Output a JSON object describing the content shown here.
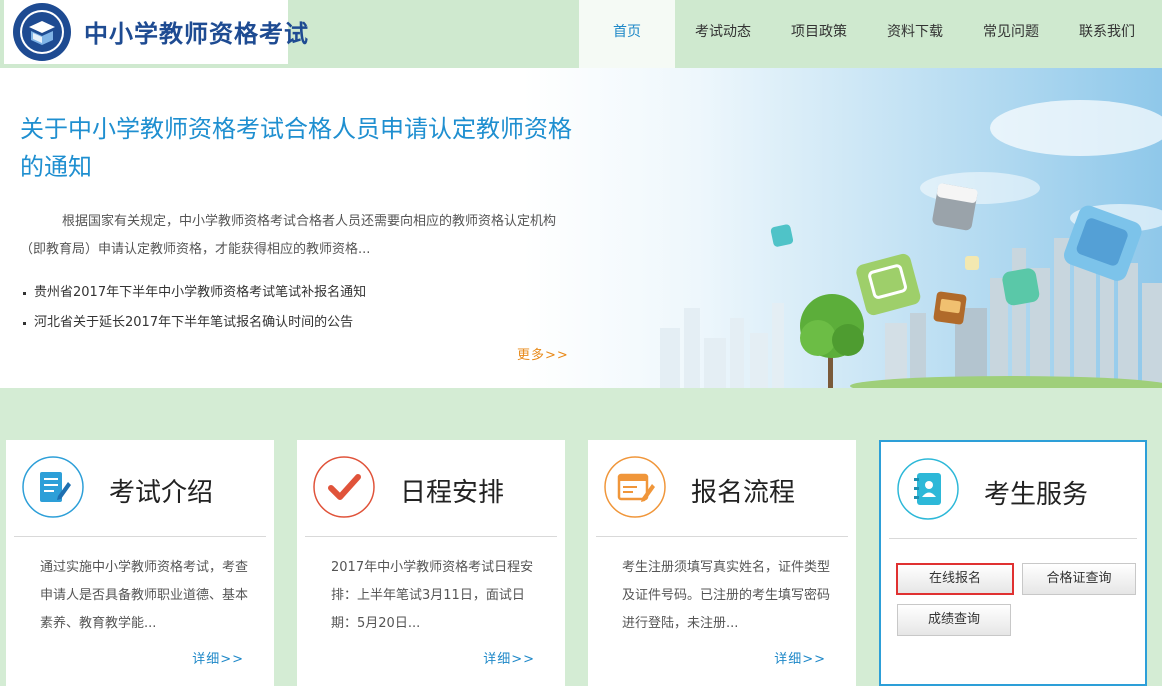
{
  "header": {
    "site_title": "中小学教师资格考试",
    "nav": [
      {
        "label": "首页",
        "active": true
      },
      {
        "label": "考试动态"
      },
      {
        "label": "项目政策"
      },
      {
        "label": "资料下载"
      },
      {
        "label": "常见问题"
      },
      {
        "label": "联系我们"
      }
    ]
  },
  "banner": {
    "title": "关于中小学教师资格考试合格人员申请认定教师资格的通知",
    "description": "根据国家有关规定，中小学教师资格考试合格者人员还需要向相应的教师资格认定机构（即教育局）申请认定教师资格，才能获得相应的教师资格...",
    "news": [
      "贵州省2017年下半年中小学教师资格考试笔试补报名通知",
      "河北省关于延长2017年下半年笔试报名确认时间的公告"
    ],
    "more_label": "更多>>"
  },
  "cards": [
    {
      "title": "考试介绍",
      "icon": "document-edit-icon",
      "text": "通过实施中小学教师资格考试，考查申请人是否具备教师职业道德、基本素养、教育教学能...",
      "more_label": "详细>>"
    },
    {
      "title": "日程安排",
      "icon": "checkmark-icon",
      "text": "2017年中小学教师资格考试日程安排：上半年笔试3月11日，面试日期：5月20日...",
      "more_label": "详细>>"
    },
    {
      "title": "报名流程",
      "icon": "form-pencil-icon",
      "text": "考生注册须填写真实姓名，证件类型及证件号码。已注册的考生填写密码进行登陆，未注册...",
      "more_label": "详细>>"
    },
    {
      "title": "考生服务",
      "icon": "contact-book-icon",
      "buttons": [
        "在线报名",
        "合格证查询",
        "成绩查询"
      ]
    }
  ],
  "colors": {
    "accent": "#1f8fd0",
    "brand": "#1e4b92",
    "orange": "#e88a1a",
    "card_blue": "#2d9fd8",
    "card_red": "#e0533a",
    "card_orange": "#f0963a",
    "selected_outline": "#e03131"
  }
}
